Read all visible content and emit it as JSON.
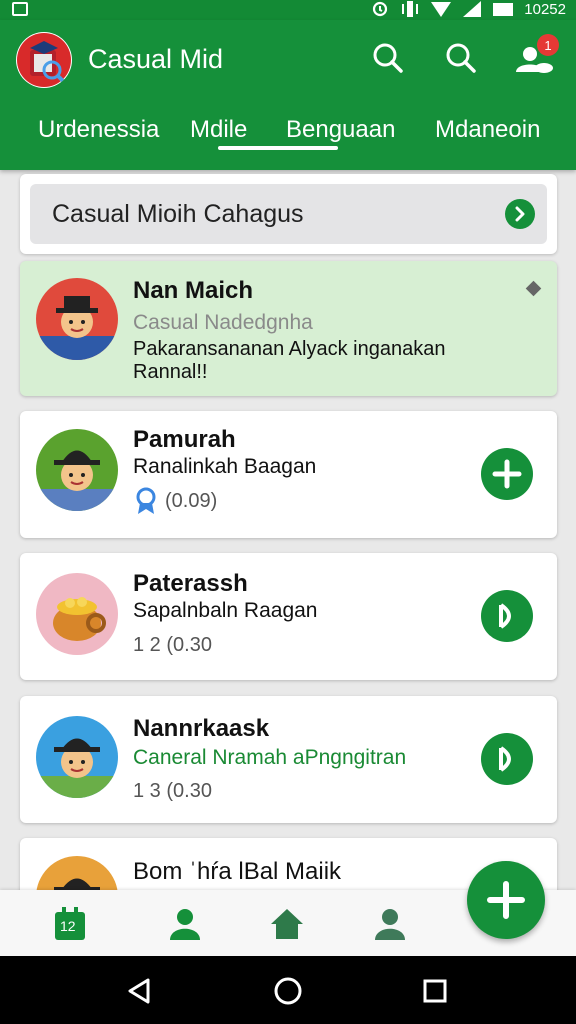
{
  "status_bar": {
    "time": "10252"
  },
  "app_bar": {
    "title": "Casual Mid",
    "notification_count": "1",
    "tabs": [
      {
        "label": "Urdenessia"
      },
      {
        "label": "Mdile"
      },
      {
        "label": "Benguaan"
      },
      {
        "label": "Mdaneoin"
      }
    ],
    "selected_tab_index": 1
  },
  "search": {
    "text": "Casual Mioih Cahagus"
  },
  "items": [
    {
      "name": "Nan Maich",
      "subtitle": "Casual Nadedgnha",
      "description_line1": "Pakaransananan Alyack inganakan",
      "description_line2": "Rannal!!"
    },
    {
      "name": "Pamurah",
      "subtitle": "Ranalinkah Baagan",
      "meta": "(0.09)",
      "action_icon": "plus-icon"
    },
    {
      "name": "Paterassh",
      "subtitle": "Sapalnbaln Raagan",
      "meta": "1 2 (0.30",
      "action_icon": "play-icon"
    },
    {
      "name": "Nannrkaask",
      "subtitle": "Caneral Nramah aPngngitran",
      "meta": "1 3 (0.30",
      "action_icon": "play-icon"
    },
    {
      "name": "Bom ˈhŕa lBal Maiik"
    }
  ],
  "bottom_nav": {
    "badge": "12"
  },
  "colors": {
    "primary": "#15903a",
    "highlight_card": "#d7efd3",
    "link_green": "#1a8a34"
  }
}
